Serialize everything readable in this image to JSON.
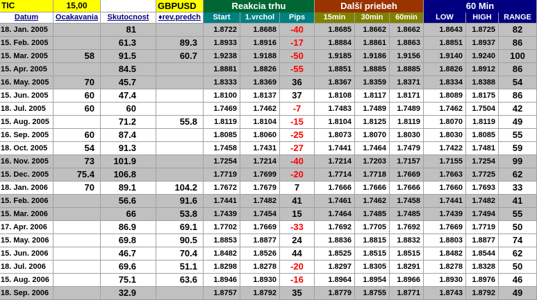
{
  "top": {
    "tic_label": "TIC",
    "tic_value": "15,00",
    "pair": "GBPUSD",
    "group_reakcia": "Reakcia trhu",
    "group_dalsi": "Další priebeh",
    "group_60": "60 Min"
  },
  "headers": [
    "Datum",
    "Ocakavania",
    "Skutocnost",
    "♦rev.predch",
    "Start",
    "1.vrchol",
    "Pips",
    "15min",
    "30min",
    "60min",
    "LOW",
    "HIGH",
    "RANGE"
  ],
  "rows": [
    {
      "datum": "18. Jan. 2005",
      "ocak": "",
      "skut": "81",
      "rev": "",
      "start": "1.8722",
      "vrchol": "1.8688",
      "pips": "-40",
      "m15": "1.8685",
      "m30": "1.8662",
      "m60": "1.8662",
      "low": "1.8643",
      "high": "1.8725",
      "range": "82",
      "shade": true
    },
    {
      "datum": "15. Feb. 2005",
      "ocak": "",
      "skut": "61.3",
      "rev": "89.3",
      "start": "1.8933",
      "vrchol": "1.8916",
      "pips": "-17",
      "m15": "1.8884",
      "m30": "1.8861",
      "m60": "1.8863",
      "low": "1.8851",
      "high": "1.8937",
      "range": "86",
      "shade": true
    },
    {
      "datum": "15. Mar. 2005",
      "ocak": "58",
      "skut": "91.5",
      "rev": "60.7",
      "start": "1.9238",
      "vrchol": "1.9188",
      "pips": "-50",
      "m15": "1.9185",
      "m30": "1.9186",
      "m60": "1.9156",
      "low": "1.9140",
      "high": "1.9240",
      "range": "100",
      "shade": true
    },
    {
      "datum": "15. Apr. 2005",
      "ocak": "",
      "skut": "84.5",
      "rev": "",
      "start": "1.8881",
      "vrchol": "1.8826",
      "pips": "-55",
      "m15": "1.8851",
      "m30": "1.8885",
      "m60": "1.8885",
      "low": "1.8826",
      "high": "1.8912",
      "range": "86",
      "shade": true
    },
    {
      "datum": "16. May. 2005",
      "ocak": "70",
      "skut": "45.7",
      "rev": "",
      "start": "1.8333",
      "vrchol": "1.8369",
      "pips": "36",
      "m15": "1.8367",
      "m30": "1.8359",
      "m60": "1.8371",
      "low": "1.8334",
      "high": "1.8388",
      "range": "54",
      "shade": true
    },
    {
      "datum": "15. Jun. 2005",
      "ocak": "60",
      "skut": "47.4",
      "rev": "",
      "start": "1.8100",
      "vrchol": "1.8137",
      "pips": "37",
      "m15": "1.8108",
      "m30": "1.8117",
      "m60": "1.8171",
      "low": "1.8089",
      "high": "1.8175",
      "range": "86",
      "shade": false
    },
    {
      "datum": "18. Jul. 2005",
      "ocak": "60",
      "skut": "60",
      "rev": "",
      "start": "1.7469",
      "vrchol": "1.7462",
      "pips": "-7",
      "m15": "1.7483",
      "m30": "1.7489",
      "m60": "1.7489",
      "low": "1.7462",
      "high": "1.7504",
      "range": "42",
      "shade": false
    },
    {
      "datum": "15. Aug. 2005",
      "ocak": "",
      "skut": "71.2",
      "rev": "55.8",
      "start": "1.8119",
      "vrchol": "1.8104",
      "pips": "-15",
      "m15": "1.8104",
      "m30": "1.8125",
      "m60": "1.8119",
      "low": "1.8070",
      "high": "1.8119",
      "range": "49",
      "shade": false
    },
    {
      "datum": "16. Sep. 2005",
      "ocak": "60",
      "skut": "87.4",
      "rev": "",
      "start": "1.8085",
      "vrchol": "1.8060",
      "pips": "-25",
      "m15": "1.8073",
      "m30": "1.8070",
      "m60": "1.8030",
      "low": "1.8030",
      "high": "1.8085",
      "range": "55",
      "shade": false
    },
    {
      "datum": "18. Oct. 2005",
      "ocak": "54",
      "skut": "91.3",
      "rev": "",
      "start": "1.7458",
      "vrchol": "1.7431",
      "pips": "-27",
      "m15": "1.7441",
      "m30": "1.7464",
      "m60": "1.7479",
      "low": "1.7422",
      "high": "1.7481",
      "range": "59",
      "shade": false
    },
    {
      "datum": "16. Nov. 2005",
      "ocak": "73",
      "skut": "101.9",
      "rev": "",
      "start": "1.7254",
      "vrchol": "1.7214",
      "pips": "-40",
      "m15": "1.7214",
      "m30": "1.7203",
      "m60": "1.7157",
      "low": "1.7155",
      "high": "1.7254",
      "range": "99",
      "shade": true
    },
    {
      "datum": "15. Dec. 2005",
      "ocak": "75.4",
      "skut": "106.8",
      "rev": "",
      "start": "1.7719",
      "vrchol": "1.7699",
      "pips": "-20",
      "m15": "1.7714",
      "m30": "1.7718",
      "m60": "1.7669",
      "low": "1.7663",
      "high": "1.7725",
      "range": "62",
      "shade": true
    },
    {
      "datum": "18. Jan. 2006",
      "ocak": "70",
      "skut": "89.1",
      "rev": "104.2",
      "start": "1.7672",
      "vrchol": "1.7679",
      "pips": "7",
      "m15": "1.7666",
      "m30": "1.7666",
      "m60": "1.7666",
      "low": "1.7660",
      "high": "1.7693",
      "range": "33",
      "shade": false
    },
    {
      "datum": "15. Feb. 2006",
      "ocak": "",
      "skut": "56.6",
      "rev": "91.6",
      "start": "1.7441",
      "vrchol": "1.7482",
      "pips": "41",
      "m15": "1.7461",
      "m30": "1.7462",
      "m60": "1.7458",
      "low": "1.7441",
      "high": "1.7482",
      "range": "41",
      "shade": true
    },
    {
      "datum": "15. Mar. 2006",
      "ocak": "",
      "skut": "66",
      "rev": "53.8",
      "start": "1.7439",
      "vrchol": "1.7454",
      "pips": "15",
      "m15": "1.7464",
      "m30": "1.7485",
      "m60": "1.7485",
      "low": "1.7439",
      "high": "1.7494",
      "range": "55",
      "shade": true
    },
    {
      "datum": "17. Apr. 2006",
      "ocak": "",
      "skut": "86.9",
      "rev": "69.1",
      "start": "1.7702",
      "vrchol": "1.7669",
      "pips": "-33",
      "m15": "1.7692",
      "m30": "1.7705",
      "m60": "1.7692",
      "low": "1.7669",
      "high": "1.7719",
      "range": "50",
      "shade": false
    },
    {
      "datum": "15. May. 2006",
      "ocak": "",
      "skut": "69.8",
      "rev": "90.5",
      "start": "1.8853",
      "vrchol": "1.8877",
      "pips": "24",
      "m15": "1.8836",
      "m30": "1.8815",
      "m60": "1.8832",
      "low": "1.8803",
      "high": "1.8877",
      "range": "74",
      "shade": false
    },
    {
      "datum": "15. Jun. 2006",
      "ocak": "",
      "skut": "46.7",
      "rev": "70.4",
      "start": "1.8482",
      "vrchol": "1.8526",
      "pips": "44",
      "m15": "1.8525",
      "m30": "1.8515",
      "m60": "1.8515",
      "low": "1.8482",
      "high": "1.8544",
      "range": "62",
      "shade": false
    },
    {
      "datum": "18. Jul. 2006",
      "ocak": "",
      "skut": "69.6",
      "rev": "51.1",
      "start": "1.8298",
      "vrchol": "1.8278",
      "pips": "-20",
      "m15": "1.8297",
      "m30": "1.8305",
      "m60": "1.8291",
      "low": "1.8278",
      "high": "1.8328",
      "range": "50",
      "shade": false
    },
    {
      "datum": "15. Aug. 2006",
      "ocak": "",
      "skut": "75.1",
      "rev": "63.6",
      "start": "1.8946",
      "vrchol": "1.8930",
      "pips": "-16",
      "m15": "1.8964",
      "m30": "1.8954",
      "m60": "1.8966",
      "low": "1.8930",
      "high": "1.8976",
      "range": "46",
      "shade": false
    },
    {
      "datum": "18. Sep. 2006",
      "ocak": "",
      "skut": "32.9",
      "rev": "",
      "start": "1.8757",
      "vrchol": "1.8792",
      "pips": "35",
      "m15": "1.8779",
      "m30": "1.8755",
      "m60": "1.8771",
      "low": "1.8743",
      "high": "1.8792",
      "range": "49",
      "shade": true
    }
  ],
  "colors": {
    "shade": "#c0c0c0",
    "white": "#ffffff",
    "negative": "#ff0000"
  }
}
